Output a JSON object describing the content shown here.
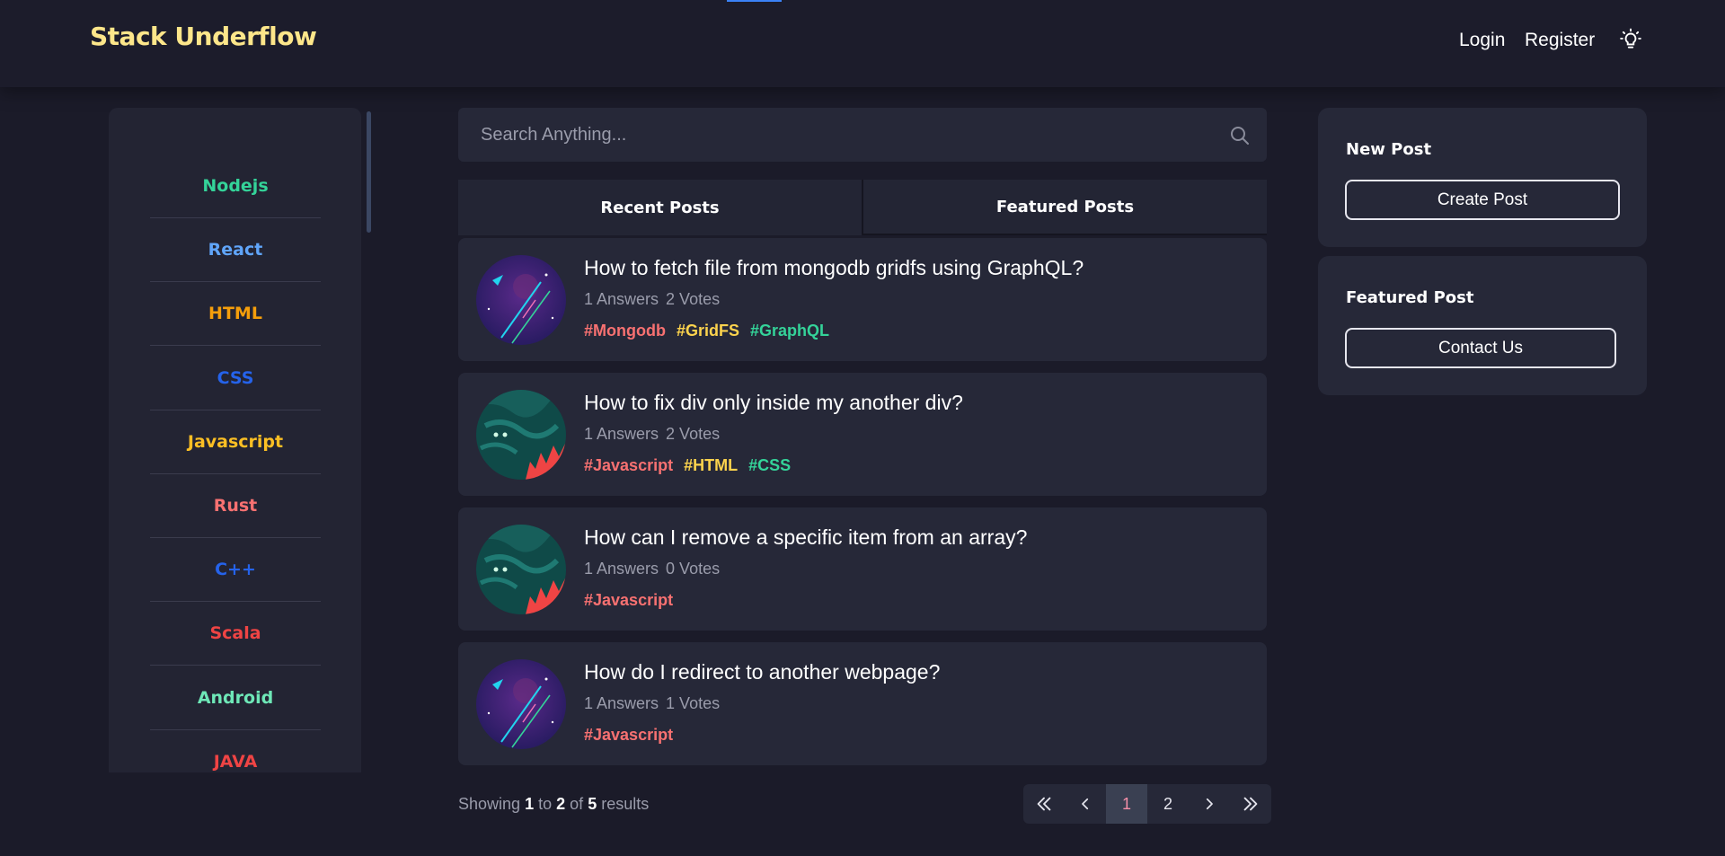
{
  "header": {
    "brand": "Stack Underflow",
    "login": "Login",
    "register": "Register",
    "theme_icon": "lightbulb-icon"
  },
  "sidebar": {
    "items": [
      {
        "label": "Nodejs",
        "color": "#34d399"
      },
      {
        "label": "React",
        "color": "#60a5fa"
      },
      {
        "label": "HTML",
        "color": "#f59e0b"
      },
      {
        "label": "CSS",
        "color": "#2563eb"
      },
      {
        "label": "Javascript",
        "color": "#fbbf24"
      },
      {
        "label": "Rust",
        "color": "#f87171"
      },
      {
        "label": "C++",
        "color": "#2563eb"
      },
      {
        "label": "Scala",
        "color": "#ef4444"
      },
      {
        "label": "Android",
        "color": "#6ee7b7"
      },
      {
        "label": "JAVA",
        "color": "#ef4444"
      }
    ]
  },
  "search": {
    "placeholder": "Search Anything..."
  },
  "tabs": {
    "recent": "Recent Posts",
    "featured": "Featured Posts"
  },
  "posts": [
    {
      "title": "How to fetch file from mongodb gridfs using GraphQL?",
      "answers": "1 Answers",
      "votes": "2 Votes",
      "avatar": "purple-space-avatar",
      "tags": [
        {
          "label": "#Mongodb",
          "color": "#f87171"
        },
        {
          "label": "#GridFS",
          "color": "#fcd34d"
        },
        {
          "label": "#GraphQL",
          "color": "#34d399"
        }
      ]
    },
    {
      "title": "How to fix div only inside my another div?",
      "answers": "1 Answers",
      "votes": "2 Votes",
      "avatar": "teal-monster-avatar",
      "tags": [
        {
          "label": "#Javascript",
          "color": "#f87171"
        },
        {
          "label": "#HTML",
          "color": "#fcd34d"
        },
        {
          "label": "#CSS",
          "color": "#34d399"
        }
      ]
    },
    {
      "title": "How can I remove a specific item from an array?",
      "answers": "1 Answers",
      "votes": "0 Votes",
      "avatar": "teal-monster-avatar",
      "tags": [
        {
          "label": "#Javascript",
          "color": "#f87171"
        }
      ]
    },
    {
      "title": "How do I redirect to another webpage?",
      "answers": "1 Answers",
      "votes": "1 Votes",
      "avatar": "purple-space-avatar",
      "tags": [
        {
          "label": "#Javascript",
          "color": "#f87171"
        }
      ]
    }
  ],
  "pagination": {
    "showing_prefix": "Showing",
    "from": "1",
    "to_word": "to",
    "to": "2",
    "of_word": "of",
    "total": "5",
    "results_word": "results",
    "pages": [
      "1",
      "2"
    ],
    "current": "1"
  },
  "widgets": {
    "new_post_title": "New Post",
    "create_post_label": "Create Post",
    "featured_title": "Featured Post",
    "contact_label": "Contact Us"
  },
  "colors": {
    "background": "#1b1b29",
    "card": "#262838",
    "brand": "#fde68a",
    "active_page": "#f58fa8"
  }
}
